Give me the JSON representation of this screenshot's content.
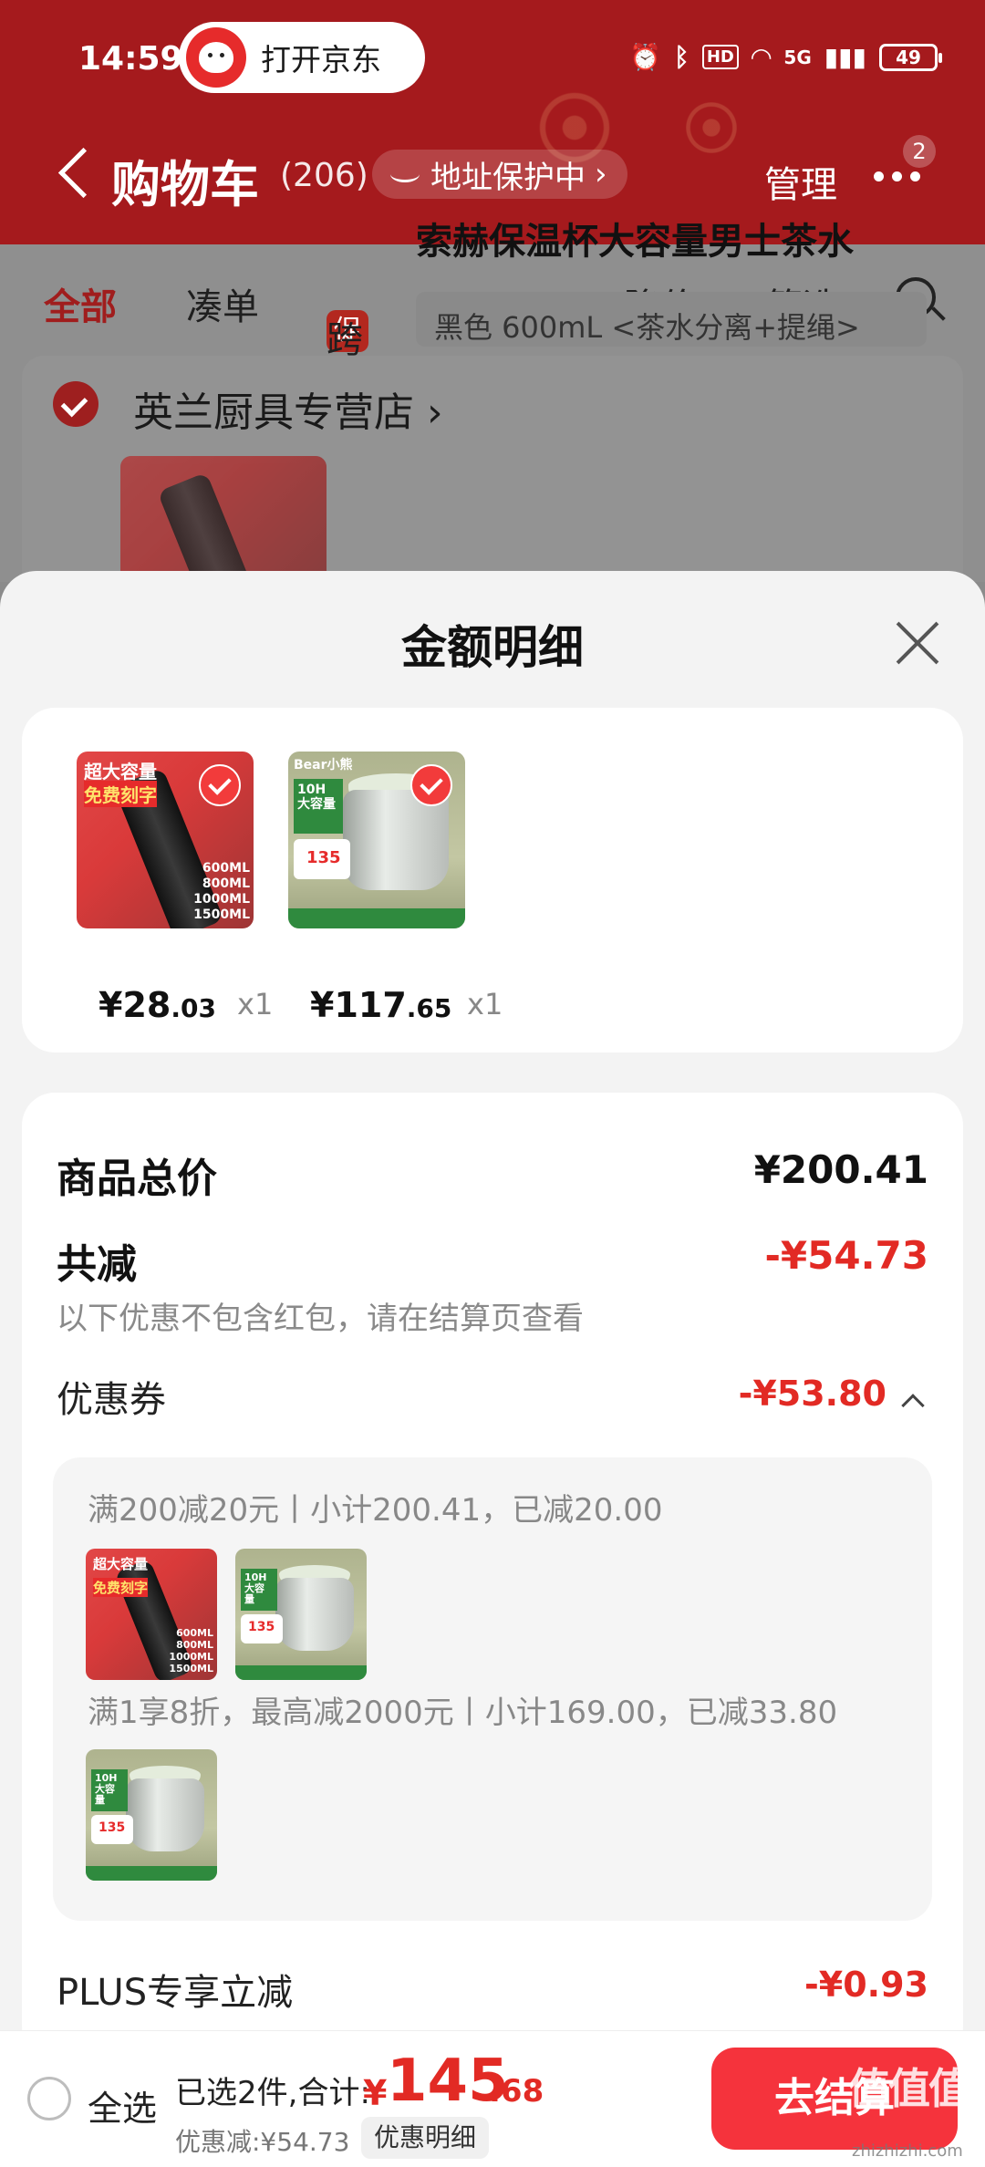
{
  "status_bar": {
    "time": "14:59",
    "open_app_label": "打开京东",
    "network": "5G",
    "hd": "HD",
    "battery": "49"
  },
  "header": {
    "title": "购物车",
    "count": "(206)",
    "address_protect": "地址保护中",
    "manage": "管理",
    "message_badge": "2"
  },
  "filter_tabs": [
    {
      "label": "全部",
      "active": true
    },
    {
      "label": "凑单"
    },
    {
      "label": "跨店满减",
      "badge": "促"
    },
    {
      "label": "降价"
    },
    {
      "label": "筛选"
    }
  ],
  "background_shop": {
    "shop_name": "英兰厨具专营店",
    "product_title": "索赫保温杯大容量男士茶水",
    "product_spec": "黑色 600mL <茶水分离+提绳>"
  },
  "sheet": {
    "title": "金额明细",
    "items": [
      {
        "price_int": "¥28",
        "price_dec": ".03",
        "qty": "x1"
      },
      {
        "price_int": "¥117",
        "price_dec": ".65",
        "qty": "x1"
      }
    ],
    "goods_total_label": "商品总价",
    "goods_total_value": "¥200.41",
    "reduction_label": "共减",
    "reduction_value": "-¥54.73",
    "reduction_note": "以下优惠不包含红包，请在结算页查看",
    "coupon_label": "优惠券",
    "coupon_value": "-¥53.80",
    "coupon_rules": [
      "满200减20元丨小计200.41，已减20.00",
      "满1享8折，最高减2000元丨小计169.00，已减33.80"
    ],
    "plus_label": "PLUS专享立减",
    "plus_value": "-¥0.93"
  },
  "bottom_bar": {
    "select_all": "全选",
    "selected_text": "已选2件,合计:",
    "total_symbol": "¥",
    "total_int": "145",
    "total_dec": ".68",
    "discount_note": "优惠减:¥54.73",
    "detail_button": "优惠明细",
    "checkout_button": "去结算"
  },
  "product_art": {
    "bottle_line1": "超大容量",
    "bottle_line2": "免费刻字",
    "bottle_sizes": "600ML\n800ML\n1000ML\n1500ML",
    "steamer_brand": "Bear小熊",
    "steamer_badge": "10H 大容量"
  },
  "watermark": {
    "text": "值值值",
    "url": "zhizhizhi.com"
  },
  "colors": {
    "header_red": "#a51a1d",
    "price_red": "#e22a24",
    "checkout_red": "#f5333c"
  }
}
